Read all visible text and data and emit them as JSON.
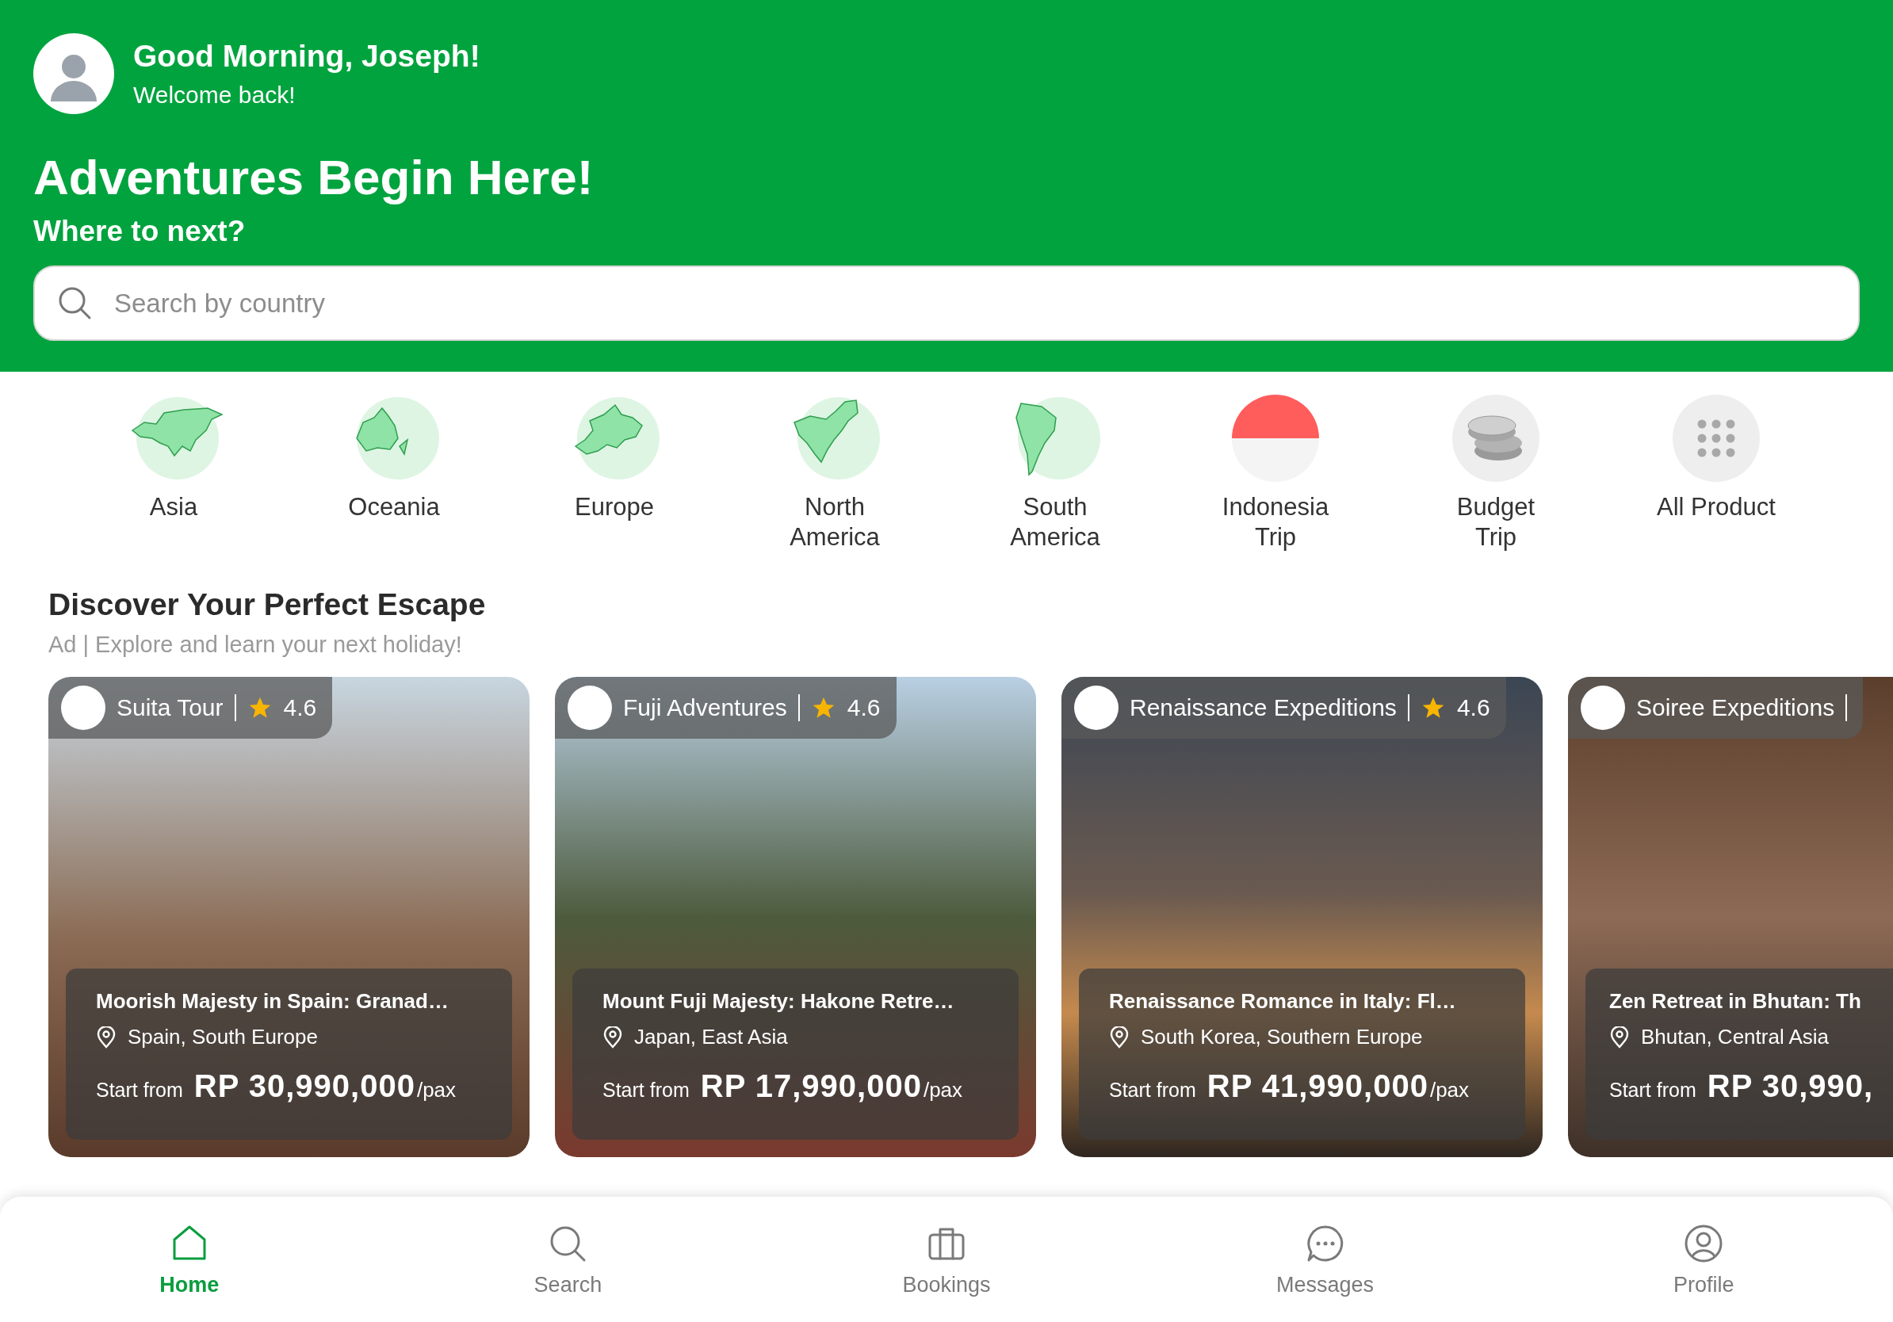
{
  "header": {
    "greeting": "Good Morning, Joseph!",
    "subtitle": "Welcome back!",
    "title": "Adventures Begin Here!",
    "prompt": "Where to next?"
  },
  "search": {
    "placeholder": "Search by country"
  },
  "categories": [
    {
      "label": "Asia",
      "kind": "asia"
    },
    {
      "label": "Oceania",
      "kind": "oceania"
    },
    {
      "label": "Europe",
      "kind": "europe"
    },
    {
      "label": "North America",
      "kind": "north-america"
    },
    {
      "label": "South America",
      "kind": "south-america"
    },
    {
      "label": "Indonesia Trip",
      "kind": "flag"
    },
    {
      "label": "Budget Trip",
      "kind": "coins"
    },
    {
      "label": "All Product",
      "kind": "grid"
    }
  ],
  "section": {
    "title": "Discover Your Perfect Escape",
    "subtitle": "Ad | Explore and learn your next holiday!"
  },
  "cards": [
    {
      "agency": "Suita Tour",
      "rating": "4.6",
      "title": "Moorish Majesty in Spain: Granad…",
      "location": "Spain, South Europe",
      "price_label": "Start from",
      "price": "RP 30,990,000",
      "unit": "/pax"
    },
    {
      "agency": "Fuji Adventures",
      "rating": "4.6",
      "title": "Mount Fuji Majesty: Hakone Retre…",
      "location": "Japan, East Asia",
      "price_label": "Start from",
      "price": "RP 17,990,000",
      "unit": "/pax"
    },
    {
      "agency": "Renaissance Expeditions",
      "rating": "4.6",
      "title": "Renaissance Romance in Italy: Fl…",
      "location": "South Korea, Southern Europe",
      "price_label": "Start from",
      "price": "RP 41,990,000",
      "unit": "/pax"
    },
    {
      "agency": "Soiree Expeditions",
      "title": "Zen Retreat in Bhutan: Th",
      "location": "Bhutan, Central Asia",
      "price_label": "Start from",
      "price": "RP 30,990,"
    }
  ],
  "nav": [
    {
      "label": "Home",
      "kind": "home",
      "selected": true
    },
    {
      "label": "Search",
      "kind": "search",
      "selected": false
    },
    {
      "label": "Bookings",
      "kind": "briefcase",
      "selected": false
    },
    {
      "label": "Messages",
      "kind": "chat",
      "selected": false
    },
    {
      "label": "Profile",
      "kind": "profile",
      "selected": false
    }
  ]
}
